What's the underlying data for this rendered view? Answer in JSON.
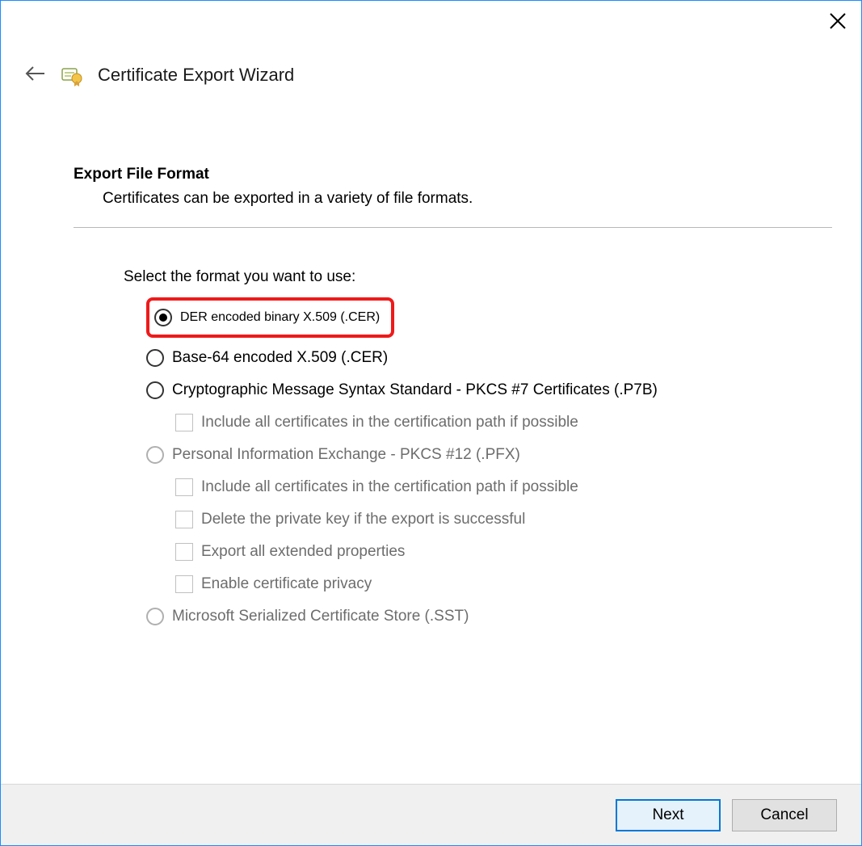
{
  "window": {
    "title": "Certificate Export Wizard"
  },
  "section": {
    "heading": "Export File Format",
    "description": "Certificates can be exported in a variety of file formats."
  },
  "prompt": "Select the format you want to use:",
  "opts": {
    "der": "DER encoded binary X.509 (.CER)",
    "base64": "Base-64 encoded X.509 (.CER)",
    "p7b": "Cryptographic Message Syntax Standard - PKCS #7 Certificates (.P7B)",
    "p7b_include": "Include all certificates in the certification path if possible",
    "pfx": "Personal Information Exchange - PKCS #12 (.PFX)",
    "pfx_include": "Include all certificates in the certification path if possible",
    "pfx_delete": "Delete the private key if the export is successful",
    "pfx_extprops": "Export all extended properties",
    "pfx_privacy": "Enable certificate privacy",
    "sst": "Microsoft Serialized Certificate Store (.SST)"
  },
  "buttons": {
    "next": "Next",
    "cancel": "Cancel"
  }
}
